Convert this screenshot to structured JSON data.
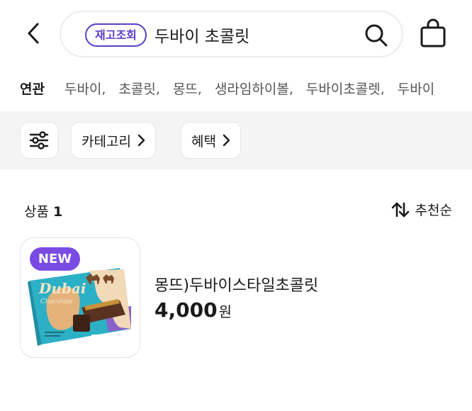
{
  "header": {
    "stock_chip": "재고조회",
    "search_value": "두바이 초콜릿",
    "back_icon": "chevron-left-icon",
    "search_icon": "search-icon",
    "bag_icon": "shopping-bag-icon"
  },
  "related": {
    "label": "연관",
    "items": [
      "두바이,",
      "초콜릿,",
      "몽뜨,",
      "생라임하이볼,",
      "두바이초콜렛,",
      "두바이"
    ]
  },
  "filters": {
    "filter_icon": "sliders-icon",
    "chips": [
      {
        "label": "카테고리"
      },
      {
        "label": "혜택"
      }
    ]
  },
  "results": {
    "count_label": "상품",
    "count": "1",
    "sort_label": "추천순",
    "sort_icon": "sort-arrows-icon"
  },
  "products": [
    {
      "badge": "NEW",
      "name": "몽뜨)두바이스타일초콜릿",
      "price": "4,000",
      "unit": "원",
      "box_title": "Dubai",
      "box_subtitle": "Chocolate"
    }
  ],
  "colors": {
    "accent": "#5b3ec8",
    "badge": "#7a4be3",
    "band": "#f4f4f4",
    "box_teal": "#2bb0c6"
  }
}
